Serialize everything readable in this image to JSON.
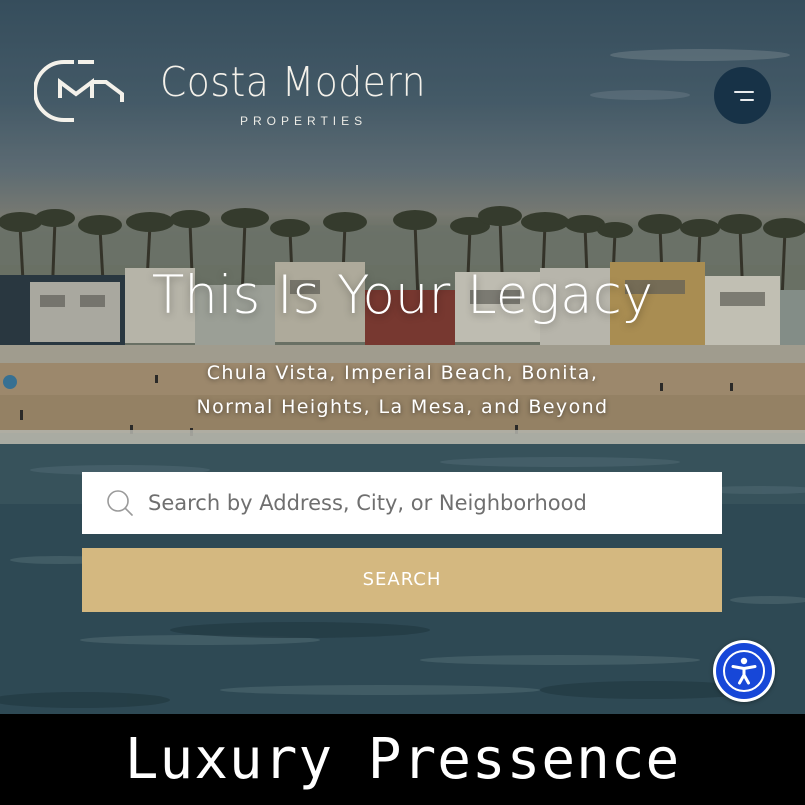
{
  "brand": {
    "name": "Costa Modern",
    "tagline": "PROPERTIES"
  },
  "header": {
    "menu_icon": "hamburger-menu-icon"
  },
  "hero": {
    "headline": "This Is Your Legacy",
    "subhead_line1": "Chula Vista, Imperial Beach, Bonita,",
    "subhead_line2": "Normal Heights, La Mesa, and Beyond"
  },
  "search": {
    "placeholder": "Search by Address, City, or Neighborhood",
    "value": "",
    "icon": "search-icon",
    "button_label": "SEARCH"
  },
  "accessibility": {
    "icon": "accessibility-person-icon"
  },
  "footer": {
    "caption": "Luxury Pressence"
  },
  "colors": {
    "menu_button": "#173247",
    "search_button": "#d4b880",
    "accessibility_button": "#1747d8",
    "footer_background": "#000000"
  }
}
